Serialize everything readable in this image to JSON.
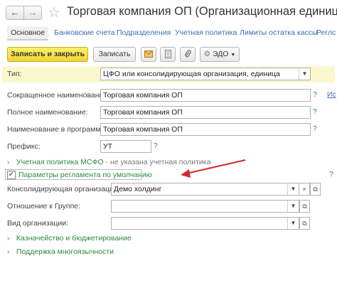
{
  "window": {
    "title": "Торговая компания ОП (Организационная единица)",
    "back_icon": "arrow-left-icon",
    "forward_icon": "arrow-right-icon",
    "favorite_icon": "star-icon"
  },
  "tabs": [
    {
      "label": "Основное",
      "active": true
    },
    {
      "label": "Банковские счета",
      "active": false
    },
    {
      "label": "Подразделения",
      "active": false
    },
    {
      "label": "Учетная политика",
      "active": false
    },
    {
      "label": "Лимиты остатка кассы",
      "active": false
    },
    {
      "label": "Реглс",
      "active": false
    }
  ],
  "toolbar": {
    "save_close_label": "Записать и закрыть",
    "save_label": "Записать",
    "edo_label": "ЭДО"
  },
  "form": {
    "type": {
      "label": "Тип:",
      "value": "ЦФО или консолидирующая организация, единица"
    },
    "short_name": {
      "label": "Сокращенное наименование:",
      "value": "Торговая компания ОП"
    },
    "full_name": {
      "label": "Полное наименование:",
      "value": "Торговая компания ОП"
    },
    "program_name": {
      "label": "Наименование в программе:",
      "value": "Торговая компания ОП"
    },
    "prefix": {
      "label": "Префикс:",
      "value": "УТ"
    },
    "help_mark": "?",
    "help_link": "Ис"
  },
  "groups": {
    "msfo": {
      "title": "Учетная политика МСФО",
      "note": " - не указана учетная политика"
    },
    "regulation": {
      "title": "Параметры регламента по умолчанию",
      "checked": true
    },
    "treasury": {
      "title": "Казначейство и бюджетирование"
    },
    "multilang": {
      "title": "Поддержка многоязычности"
    }
  },
  "regulation_fields": {
    "consolidating_org": {
      "label": "Консолидирующая организация:",
      "value": "Демо холдинг"
    },
    "group_relation": {
      "label": "Отношение к Группе:",
      "value": ""
    },
    "org_kind": {
      "label": "Вид организации:",
      "value": ""
    }
  },
  "colors": {
    "accent_yellow": "#f1d431",
    "highlight_row": "#fbf7cd",
    "group_green": "#2c8a3c",
    "link_blue": "#3c6fb0",
    "annotation_arrow": "#d62828"
  }
}
